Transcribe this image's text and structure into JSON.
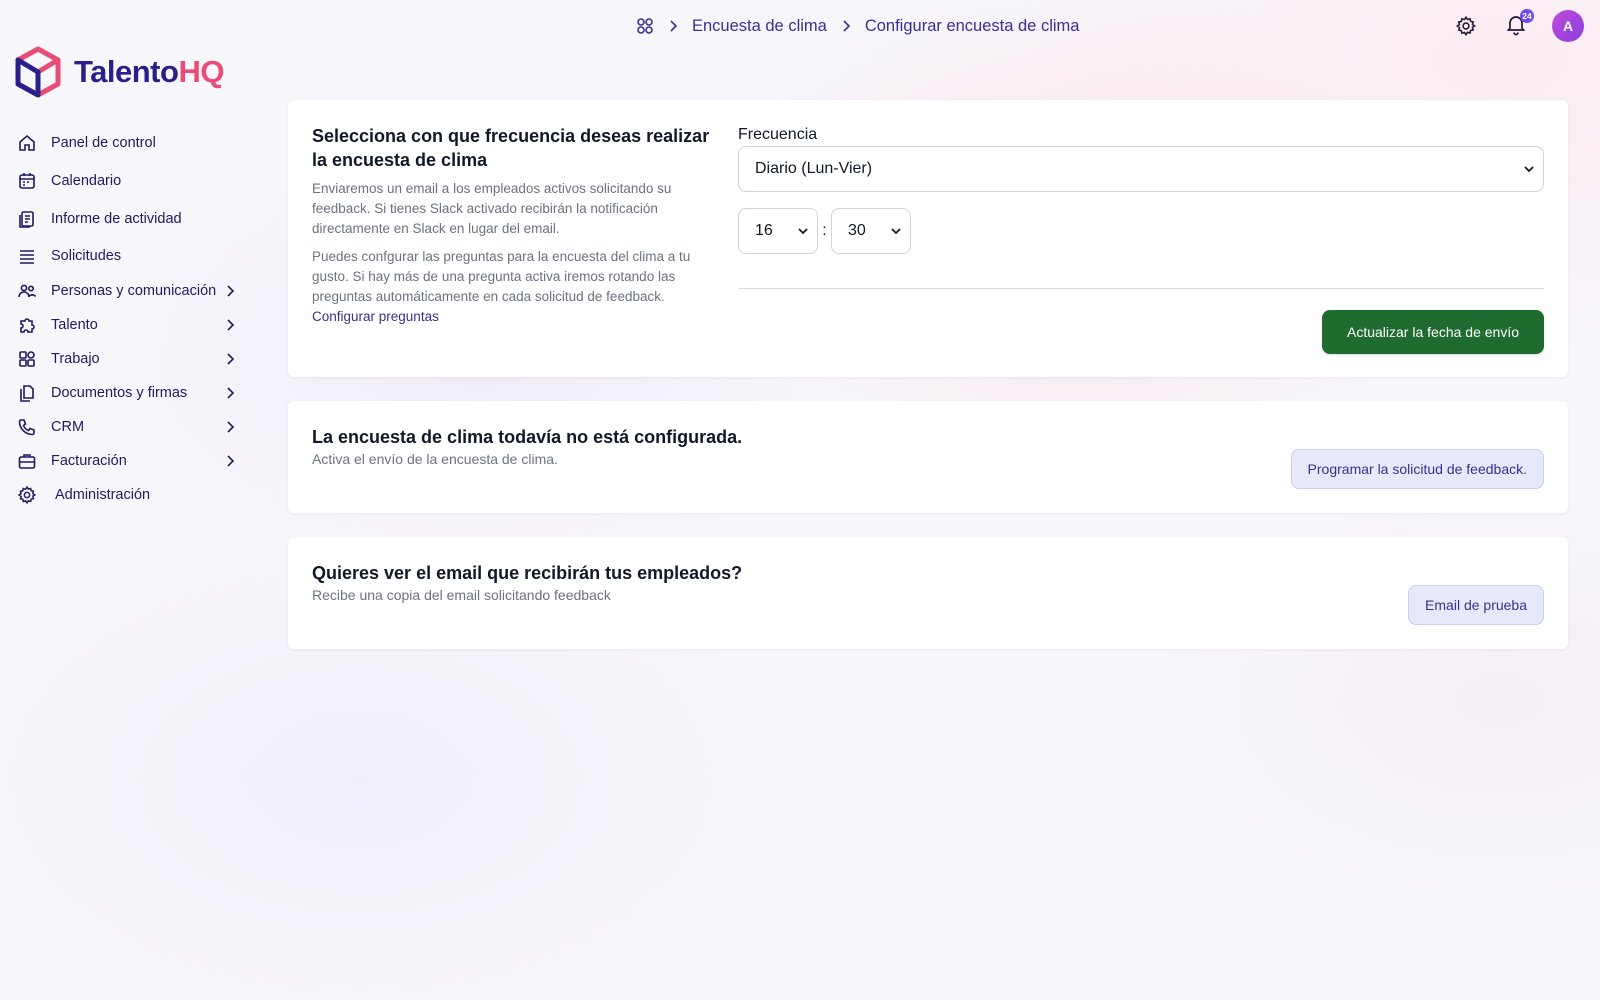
{
  "breadcrumb": {
    "items": [
      "Encuesta de clima",
      "Configurar encuesta de clima"
    ]
  },
  "header": {
    "notifications_count": "24",
    "avatar_initial": "A"
  },
  "brand": {
    "name_part1": "Talento",
    "name_part2": "HQ",
    "colors": {
      "primary": "#2a1f8a",
      "accent": "#e94d77"
    }
  },
  "sidebar": {
    "items": [
      {
        "label": "Panel de control",
        "icon": "home-icon",
        "expandable": false
      },
      {
        "label": "Calendario",
        "icon": "calendar-icon",
        "expandable": false
      },
      {
        "label": "Informe de actividad",
        "icon": "report-icon",
        "expandable": false
      },
      {
        "label": "Solicitudes",
        "icon": "list-icon",
        "expandable": false
      },
      {
        "label": "Personas y comunicación",
        "icon": "people-icon",
        "expandable": true
      },
      {
        "label": "Talento",
        "icon": "puzzle-icon",
        "expandable": true
      },
      {
        "label": "Trabajo",
        "icon": "grid-icon",
        "expandable": true
      },
      {
        "label": "Documentos y firmas",
        "icon": "documents-icon",
        "expandable": true
      },
      {
        "label": "CRM",
        "icon": "phone-icon",
        "expandable": true
      },
      {
        "label": "Facturación",
        "icon": "briefcase-icon",
        "expandable": true
      },
      {
        "label": "Administración",
        "icon": "gear-icon",
        "expandable": false
      }
    ]
  },
  "frequency_card": {
    "title": "Selecciona con que frecuencia deseas realizar la encuesta de clima",
    "text1": "Enviaremos un email a los empleados activos solicitando su feedback. Si tienes Slack activado recibirán la notificación directamente en Slack en lugar del email.",
    "text2": "Puedes confgurar las preguntas para la encuesta del clima a tu gusto. Si hay más de una pregunta activa iremos rotando las preguntas automáticamente en cada solicitud de feedback.",
    "link": "Configurar preguntas",
    "frequency_label": "Frecuencia",
    "frequency_value": "Diario (Lun-Vier)",
    "hour_value": "16",
    "minute_value": "30",
    "time_separator": ":",
    "submit_label": "Actualizar la fecha de envío",
    "submit_color": "#1f6b30"
  },
  "status_card": {
    "title": "La encuesta de clima todavía no está configurada.",
    "subtitle": "Activa el envío de la encuesta de clima.",
    "button_label": "Programar la solicitud de feedback."
  },
  "email_card": {
    "title": "Quieres ver el email que recibirán tus empleados?",
    "subtitle": "Recibe una copia del email solicitando feedback",
    "button_label": "Email de prueba"
  }
}
